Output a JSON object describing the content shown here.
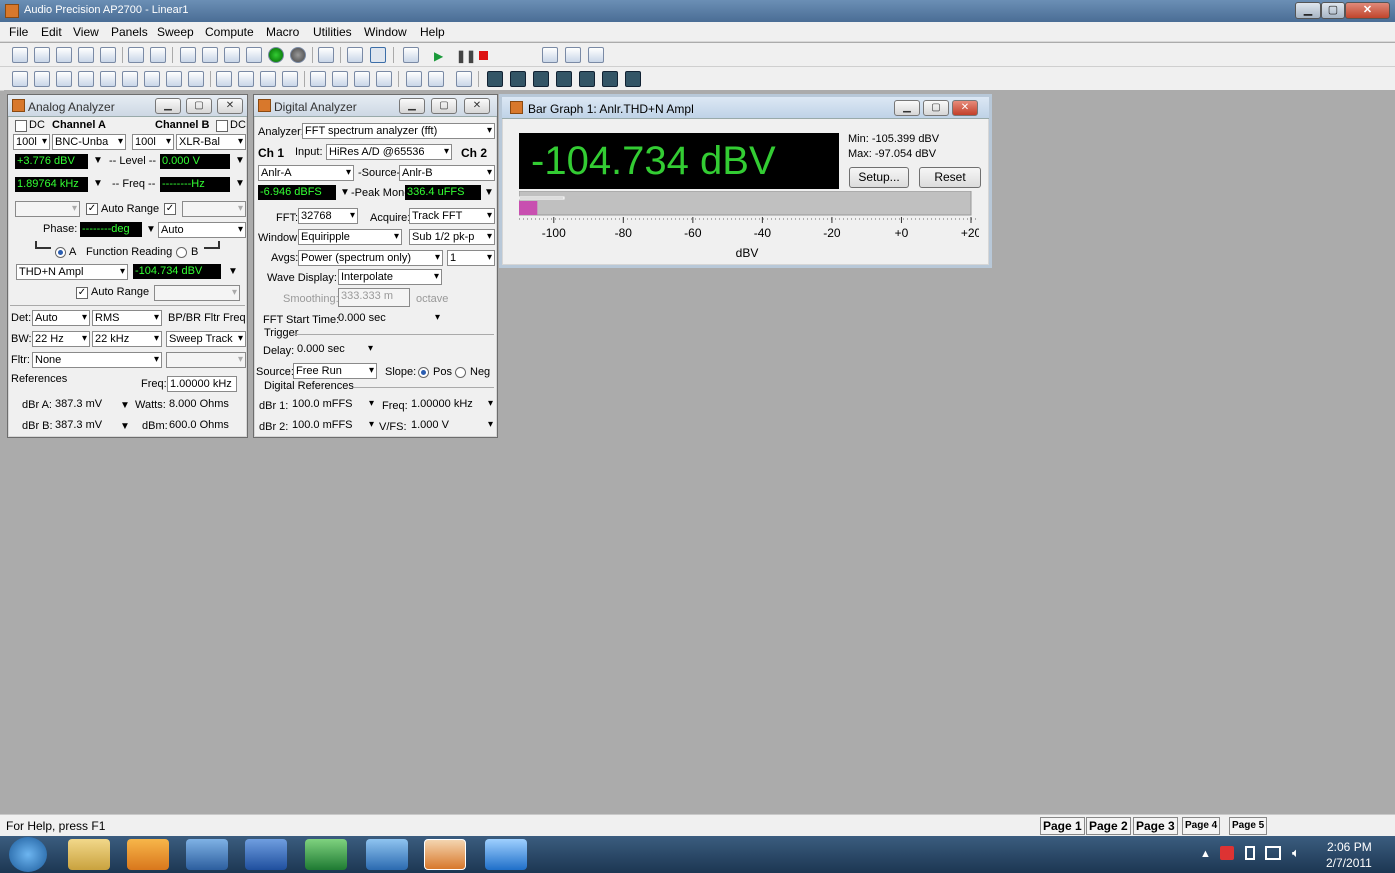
{
  "app": {
    "title": "Audio Precision AP2700 - Linear1",
    "min": "▁",
    "max": "▢",
    "close": "✕"
  },
  "menu": [
    "File",
    "Edit",
    "View",
    "Panels",
    "Sweep",
    "Compute",
    "Macro",
    "Utilities",
    "Window",
    "Help"
  ],
  "analog": {
    "title": "Analog Analyzer",
    "dc": "DC",
    "chA": "Channel A",
    "chB": "Channel B",
    "impA": "100l",
    "inA": "BNC-Unba",
    "impB": "100l",
    "inB": "XLR-Bal",
    "levelVal": "+3.776  dBV",
    "levelLbl": "-- Level --",
    "levelB": "0.000   V",
    "freqVal": "1.89764 kHz",
    "freqLbl": "-- Freq --",
    "freqB": "--------Hz",
    "autoRange": "Auto Range",
    "phaseLbl": "Phase:",
    "phaseVal": "--------deg",
    "phaseMode": "Auto",
    "radioA": "A",
    "funcReading": "Function Reading",
    "radioB": "B",
    "funcSel": "THD+N Ampl",
    "funcVal": "-104.734 dBV",
    "autoRange2": "Auto Range",
    "detLbl": "Det:",
    "det": "Auto",
    "detType": "RMS",
    "bpbr": "BP/BR Fltr Freq",
    "bwLbl": "BW:",
    "bwLow": "22 Hz",
    "bwHigh": "22 kHz",
    "sweepTrack": "Sweep Track",
    "fltrLbl": "Fltr:",
    "fltr": "None",
    "refs": "References",
    "freqRefLbl": "Freq:",
    "freqRef": "1.00000 kHz",
    "dbraLbl": "dBr A:",
    "dbra": "387.3  mV",
    "wattsLbl": "Watts:",
    "watts": "8.000   Ohms",
    "dbrbLbl": "dBr B:",
    "dbrb": "387.3  mV",
    "dbmLbl": "dBm:",
    "dbm": "600.0   Ohms"
  },
  "digital": {
    "title": "Digital Analyzer",
    "analyzerLbl": "Analyzer:",
    "analyzer": "FFT spectrum analyzer (fft)",
    "ch1": "Ch 1",
    "inputLbl": "Input:",
    "input": "HiRes A/D @65536",
    "ch2": "Ch 2",
    "srcA": "Anlr-A",
    "srcLbl": "-Source-",
    "srcB": "Anlr-B",
    "levelVal": "-6.946  dBFS",
    "peakLbl": "-Peak Mon-",
    "peakVal": "336.4  uFFS",
    "fftLbl": "FFT:",
    "fft": "32768",
    "acquireLbl": "Acquire:",
    "acquire": "Track FFT",
    "windowLbl": "Window:",
    "window": "Equiripple",
    "sub": "Sub 1/2 pk-p",
    "avgsLbl": "Avgs:",
    "avgs": "Power (spectrum only)",
    "avgN": "1",
    "waveLbl": "Wave Display:",
    "wave": "Interpolate",
    "smoothLbl": "Smoothing:",
    "smooth": "333.333 m",
    "octave": "octave",
    "fftStartLbl": "FFT Start Time:",
    "fftStart": "0.000   sec",
    "trigger": "Trigger",
    "delayLbl": "Delay:",
    "delay": "0.000   sec",
    "sourceLbl": "Source:",
    "source": "Free Run",
    "slopeLbl": "Slope:",
    "pos": "Pos",
    "neg": "Neg",
    "digRefs": "Digital References",
    "dbr1Lbl": "dBr 1:",
    "dbr1": "100.0   mFFS",
    "freqLbl": "Freq:",
    "freq": "1.00000 kHz",
    "dbr2Lbl": "dBr 2:",
    "dbr2": "100.0   mFFS",
    "vfsLbl": "V/FS:",
    "vfs": "1.000   V"
  },
  "bargraph": {
    "title": "Bar Graph 1: Anlr.THD+N Ampl",
    "reading": "-104.734 dBV",
    "min": "Min: -105.399 dBV",
    "max": "Max: -97.054  dBV",
    "setup": "Setup...",
    "reset": "Reset",
    "ticks": [
      "-100",
      "-80",
      "-60",
      "-40",
      "-20",
      "+0",
      "+20"
    ],
    "unit": "dBV",
    "scale_min": -110,
    "scale_max": 20,
    "value": -104.734,
    "peak": -97.054,
    "displayColor": "#33cc33",
    "barColor": "#c84fb0"
  },
  "status": {
    "help": "For Help, press F1"
  },
  "pages": [
    "Page 1",
    "Page 2",
    "Page 3",
    "Page 4",
    "Page 5"
  ],
  "clock": {
    "time": "2:06 PM",
    "date": "2/7/2011"
  }
}
